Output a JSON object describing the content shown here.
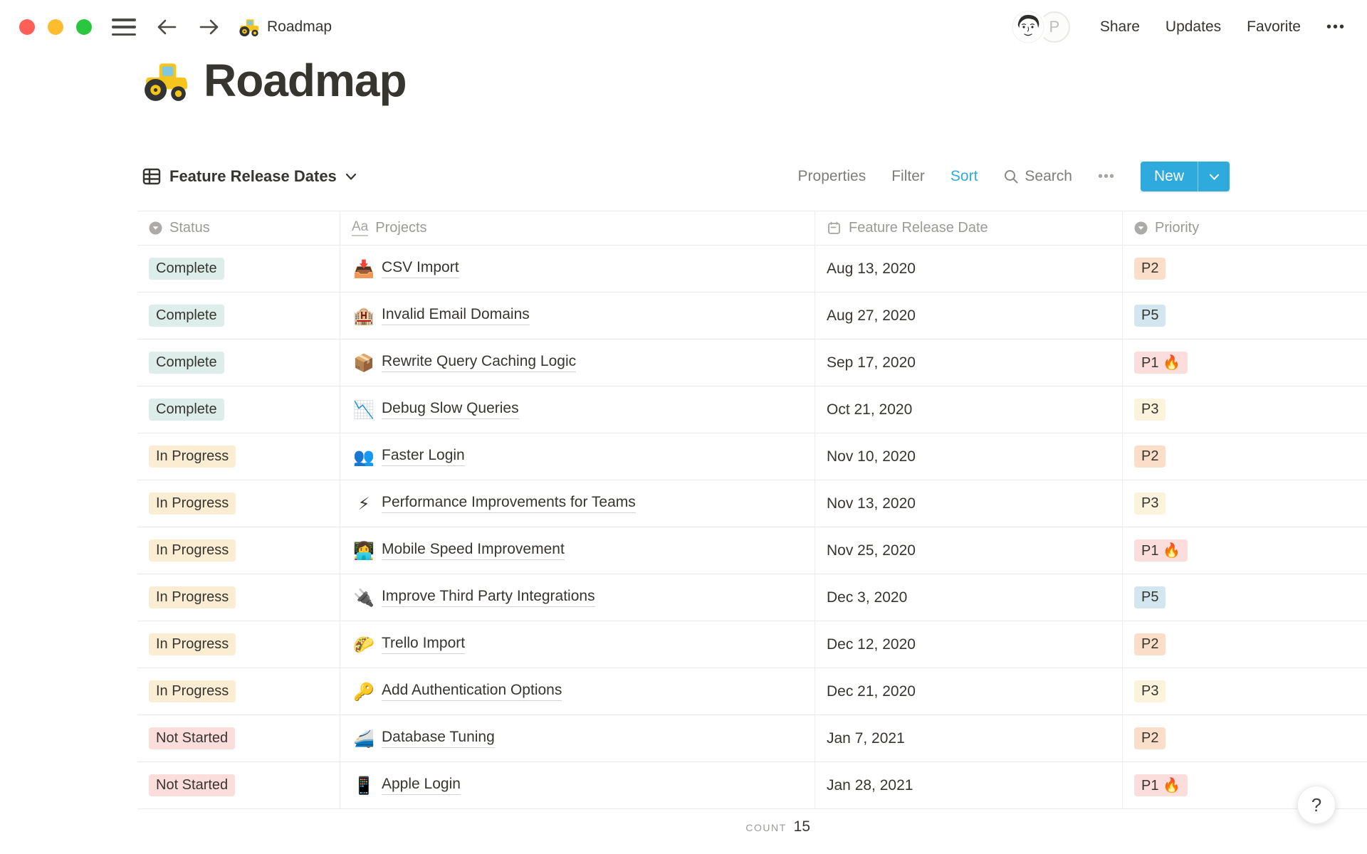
{
  "topbar": {
    "doc_icon": "🚜",
    "doc_title": "Roadmap",
    "avatar_letter": "P",
    "share": "Share",
    "updates": "Updates",
    "favorite": "Favorite",
    "more": "•••"
  },
  "page": {
    "icon": "🚜",
    "title": "Roadmap"
  },
  "toolbar": {
    "view_name": "Feature Release Dates",
    "properties": "Properties",
    "filter": "Filter",
    "sort": "Sort",
    "search": "Search",
    "more": "•••",
    "new_label": "New",
    "accent_blue": "#2EAADC"
  },
  "table": {
    "columns": [
      {
        "label": "Status",
        "icon": "select-icon"
      },
      {
        "label": "Projects",
        "icon": "text-icon",
        "icon_glyph": "Aa"
      },
      {
        "label": "Feature Release Date",
        "icon": "calendar-icon"
      },
      {
        "label": "Priority",
        "icon": "select-icon"
      }
    ],
    "status_colors": {
      "Complete": "#DDEDEA",
      "In Progress": "#FAEDD3",
      "Not Started": "#FBDDDC"
    },
    "priority_colors": {
      "P1": "#FBDDDC",
      "P2": "#FADEC9",
      "P3": "#FBF3DB",
      "P5": "#D3E5EF"
    },
    "rows": [
      {
        "status": "Complete",
        "status_bg": "#DDEDEA",
        "emoji": "📥",
        "project": "CSV Import",
        "date": "Aug 13, 2020",
        "priority": "P2",
        "priority_bg": "#FADEC9"
      },
      {
        "status": "Complete",
        "status_bg": "#DDEDEA",
        "emoji": "🏨",
        "project": "Invalid Email Domains",
        "date": "Aug 27, 2020",
        "priority": "P5",
        "priority_bg": "#D3E5EF"
      },
      {
        "status": "Complete",
        "status_bg": "#DDEDEA",
        "emoji": "📦",
        "project": "Rewrite Query Caching Logic",
        "date": "Sep 17, 2020",
        "priority": "P1 🔥",
        "priority_bg": "#FBDDDC"
      },
      {
        "status": "Complete",
        "status_bg": "#DDEDEA",
        "emoji": "📉",
        "project": "Debug Slow Queries",
        "date": "Oct 21, 2020",
        "priority": "P3",
        "priority_bg": "#FBF3DB"
      },
      {
        "status": "In Progress",
        "status_bg": "#FAEDD3",
        "emoji": "👥",
        "project": "Faster Login",
        "date": "Nov 10, 2020",
        "priority": "P2",
        "priority_bg": "#FADEC9"
      },
      {
        "status": "In Progress",
        "status_bg": "#FAEDD3",
        "emoji": "⚡",
        "project": "Performance Improvements for Teams",
        "date": "Nov 13, 2020",
        "priority": "P3",
        "priority_bg": "#FBF3DB"
      },
      {
        "status": "In Progress",
        "status_bg": "#FAEDD3",
        "emoji": "👩‍💻",
        "project": "Mobile Speed Improvement",
        "date": "Nov 25, 2020",
        "priority": "P1 🔥",
        "priority_bg": "#FBDDDC"
      },
      {
        "status": "In Progress",
        "status_bg": "#FAEDD3",
        "emoji": "🔌",
        "project": "Improve Third Party Integrations",
        "date": "Dec 3, 2020",
        "priority": "P5",
        "priority_bg": "#D3E5EF"
      },
      {
        "status": "In Progress",
        "status_bg": "#FAEDD3",
        "emoji": "🌮",
        "project": "Trello Import",
        "date": "Dec 12, 2020",
        "priority": "P2",
        "priority_bg": "#FADEC9"
      },
      {
        "status": "In Progress",
        "status_bg": "#FAEDD3",
        "emoji": "🔑",
        "project": "Add Authentication Options",
        "date": "Dec 21, 2020",
        "priority": "P3",
        "priority_bg": "#FBF3DB"
      },
      {
        "status": "Not Started",
        "status_bg": "#FBDDDC",
        "emoji": "🚄",
        "project": "Database Tuning",
        "date": "Jan 7, 2021",
        "priority": "P2",
        "priority_bg": "#FADEC9"
      },
      {
        "status": "Not Started",
        "status_bg": "#FBDDDC",
        "emoji": "📱",
        "project": "Apple Login",
        "date": "Jan 28, 2021",
        "priority": "P1 🔥",
        "priority_bg": "#FBDDDC"
      }
    ],
    "count_label": "COUNT",
    "count_value": "15"
  },
  "help_label": "?"
}
